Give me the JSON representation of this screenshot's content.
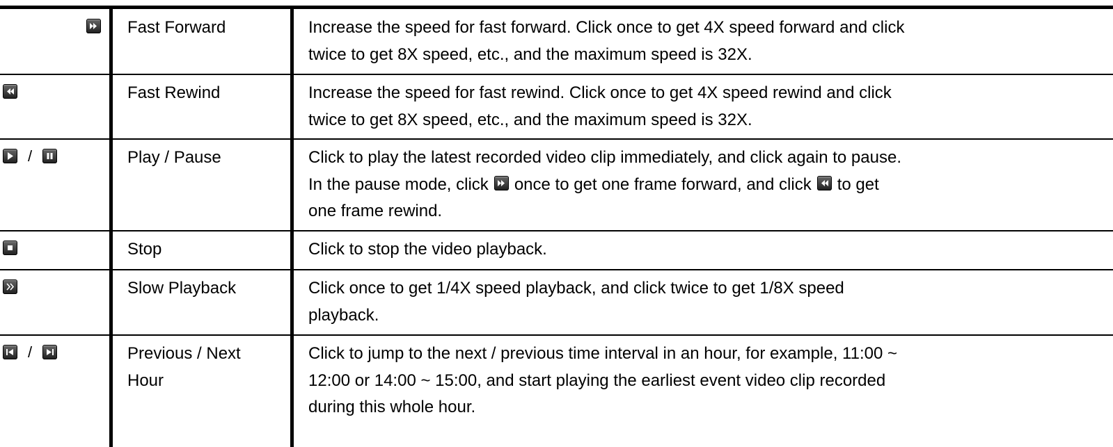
{
  "table": {
    "rows": [
      {
        "icons": [
          "fast-forward-icon"
        ],
        "name_lines": [
          "Fast Forward"
        ],
        "desc_lines": [
          "Increase the speed for fast forward. Click once to get 4X speed forward and click",
          "twice to get 8X speed, etc., and the maximum speed is 32X."
        ]
      },
      {
        "icons": [
          "fast-rewind-icon"
        ],
        "name_lines": [
          "Fast Rewind"
        ],
        "desc_lines": [
          "Increase the speed for fast rewind. Click once to get 4X speed rewind and click",
          "twice to get 8X speed, etc., and the maximum speed is 32X."
        ]
      },
      {
        "icons": [
          "play-icon",
          "pause-icon"
        ],
        "icon_separator": "/",
        "name_lines": [
          "Play / Pause"
        ],
        "desc_lines": [
          "Click to play the latest recorded video clip immediately, and click again to pause.",
          "",
          "one frame rewind."
        ],
        "desc_line2_parts": [
          "In the pause mode, click",
          "once to get one frame forward, and click",
          "to get"
        ]
      },
      {
        "icons": [
          "stop-icon"
        ],
        "name_lines": [
          "Stop"
        ],
        "desc_lines": [
          "Click to stop the video playback."
        ]
      },
      {
        "icons": [
          "slow-playback-icon"
        ],
        "name_lines": [
          "Slow Playback"
        ],
        "desc_lines": [
          "Click once to get 1/4X speed playback, and click twice to get 1/8X speed",
          "playback."
        ]
      },
      {
        "icons": [
          "previous-hour-icon",
          "next-hour-icon"
        ],
        "icon_separator": "/",
        "name_lines": [
          "Previous / Next",
          "Hour"
        ],
        "desc_lines": [
          "Click to jump to the next / previous time interval in an hour, for example, 11:00 ~",
          "12:00 or 14:00 ~ 15:00, and start playing the earliest event video clip recorded",
          "during this whole hour."
        ]
      }
    ]
  }
}
